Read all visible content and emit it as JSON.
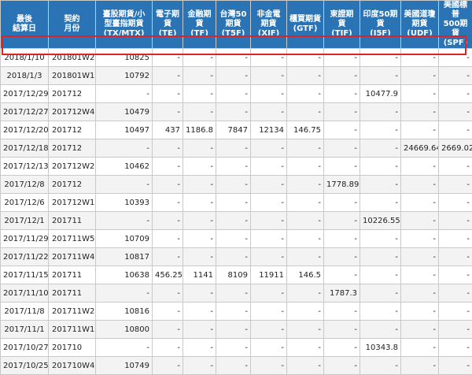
{
  "headers": [
    "最後\n結算日",
    "契約\n月份",
    "臺股期貨/小\n型臺指期貨\n(TX/MTX)",
    "電子期\n貨\n(TE)",
    "金融期\n貨\n(TF)",
    "台灣50\n期貨\n(T5F)",
    "非金電\n期貨\n(XIF)",
    "櫃買期貨\n(GTF)",
    "東證期貨\n(TJF)",
    "印度50期\n貨\n(I5F)",
    "美國道瓊\n期貨\n(UDF)",
    "美國標普\n500期貨\n(SPF)"
  ],
  "rows": [
    {
      "date": "2018/1/10",
      "month": "201801W2",
      "tx": "10825",
      "te": "-",
      "tf": "-",
      "t5f": "-",
      "xif": "-",
      "gtf": "-",
      "tjf": "-",
      "i5f": "-",
      "udf": "-",
      "spf": "-"
    },
    {
      "date": "2018/1/3",
      "month": "201801W1",
      "tx": "10792",
      "te": "-",
      "tf": "-",
      "t5f": "-",
      "xif": "-",
      "gtf": "-",
      "tjf": "-",
      "i5f": "-",
      "udf": "-",
      "spf": "-"
    },
    {
      "date": "2017/12/29",
      "month": "201712",
      "tx": "-",
      "te": "-",
      "tf": "-",
      "t5f": "-",
      "xif": "-",
      "gtf": "-",
      "tjf": "-",
      "i5f": "10477.9",
      "udf": "-",
      "spf": "-"
    },
    {
      "date": "2017/12/27",
      "month": "201712W4",
      "tx": "10479",
      "te": "-",
      "tf": "-",
      "t5f": "-",
      "xif": "-",
      "gtf": "-",
      "tjf": "-",
      "i5f": "-",
      "udf": "-",
      "spf": "-"
    },
    {
      "date": "2017/12/20",
      "month": "201712",
      "tx": "10497",
      "te": "437",
      "tf": "1186.8",
      "t5f": "7847",
      "xif": "12134",
      "gtf": "146.75",
      "tjf": "-",
      "i5f": "-",
      "udf": "-",
      "spf": "-"
    },
    {
      "date": "2017/12/18",
      "month": "201712",
      "tx": "-",
      "te": "-",
      "tf": "-",
      "t5f": "-",
      "xif": "-",
      "gtf": "-",
      "tjf": "-",
      "i5f": "-",
      "udf": "24669.64",
      "spf": "2669.02"
    },
    {
      "date": "2017/12/13",
      "month": "201712W2",
      "tx": "10462",
      "te": "-",
      "tf": "-",
      "t5f": "-",
      "xif": "-",
      "gtf": "-",
      "tjf": "-",
      "i5f": "-",
      "udf": "-",
      "spf": "-"
    },
    {
      "date": "2017/12/8",
      "month": "201712",
      "tx": "-",
      "te": "-",
      "tf": "-",
      "t5f": "-",
      "xif": "-",
      "gtf": "-",
      "tjf": "1778.89",
      "i5f": "-",
      "udf": "-",
      "spf": "-"
    },
    {
      "date": "2017/12/6",
      "month": "201712W1",
      "tx": "10393",
      "te": "-",
      "tf": "-",
      "t5f": "-",
      "xif": "-",
      "gtf": "-",
      "tjf": "-",
      "i5f": "-",
      "udf": "-",
      "spf": "-"
    },
    {
      "date": "2017/12/1",
      "month": "201711",
      "tx": "-",
      "te": "-",
      "tf": "-",
      "t5f": "-",
      "xif": "-",
      "gtf": "-",
      "tjf": "-",
      "i5f": "10226.55",
      "udf": "-",
      "spf": "-"
    },
    {
      "date": "2017/11/29",
      "month": "201711W5",
      "tx": "10709",
      "te": "-",
      "tf": "-",
      "t5f": "-",
      "xif": "-",
      "gtf": "-",
      "tjf": "-",
      "i5f": "-",
      "udf": "-",
      "spf": "-"
    },
    {
      "date": "2017/11/22",
      "month": "201711W4",
      "tx": "10817",
      "te": "-",
      "tf": "-",
      "t5f": "-",
      "xif": "-",
      "gtf": "-",
      "tjf": "-",
      "i5f": "-",
      "udf": "-",
      "spf": "-"
    },
    {
      "date": "2017/11/15",
      "month": "201711",
      "tx": "10638",
      "te": "456.25",
      "tf": "1141",
      "t5f": "8109",
      "xif": "11911",
      "gtf": "146.5",
      "tjf": "-",
      "i5f": "-",
      "udf": "-",
      "spf": "-"
    },
    {
      "date": "2017/11/10",
      "month": "201711",
      "tx": "-",
      "te": "-",
      "tf": "-",
      "t5f": "-",
      "xif": "-",
      "gtf": "-",
      "tjf": "1787.3",
      "i5f": "-",
      "udf": "-",
      "spf": "-"
    },
    {
      "date": "2017/11/8",
      "month": "201711W2",
      "tx": "10816",
      "te": "-",
      "tf": "-",
      "t5f": "-",
      "xif": "-",
      "gtf": "-",
      "tjf": "-",
      "i5f": "-",
      "udf": "-",
      "spf": "-"
    },
    {
      "date": "2017/11/1",
      "month": "201711W1",
      "tx": "10800",
      "te": "-",
      "tf": "-",
      "t5f": "-",
      "xif": "-",
      "gtf": "-",
      "tjf": "-",
      "i5f": "-",
      "udf": "-",
      "spf": "-"
    },
    {
      "date": "2017/10/27",
      "month": "201710",
      "tx": "-",
      "te": "-",
      "tf": "-",
      "t5f": "-",
      "xif": "-",
      "gtf": "-",
      "tjf": "-",
      "i5f": "10343.8",
      "udf": "-",
      "spf": "-"
    },
    {
      "date": "2017/10/25",
      "month": "201710W4",
      "tx": "10749",
      "te": "-",
      "tf": "-",
      "t5f": "-",
      "xif": "-",
      "gtf": "-",
      "tjf": "-",
      "i5f": "-",
      "udf": "-",
      "spf": "-"
    }
  ],
  "colors": {
    "header_bg": "#2a74b5",
    "header_text": "#ffffff",
    "highlight_border": "#d9242a",
    "row_alt_bg": "#f3f3f3"
  }
}
